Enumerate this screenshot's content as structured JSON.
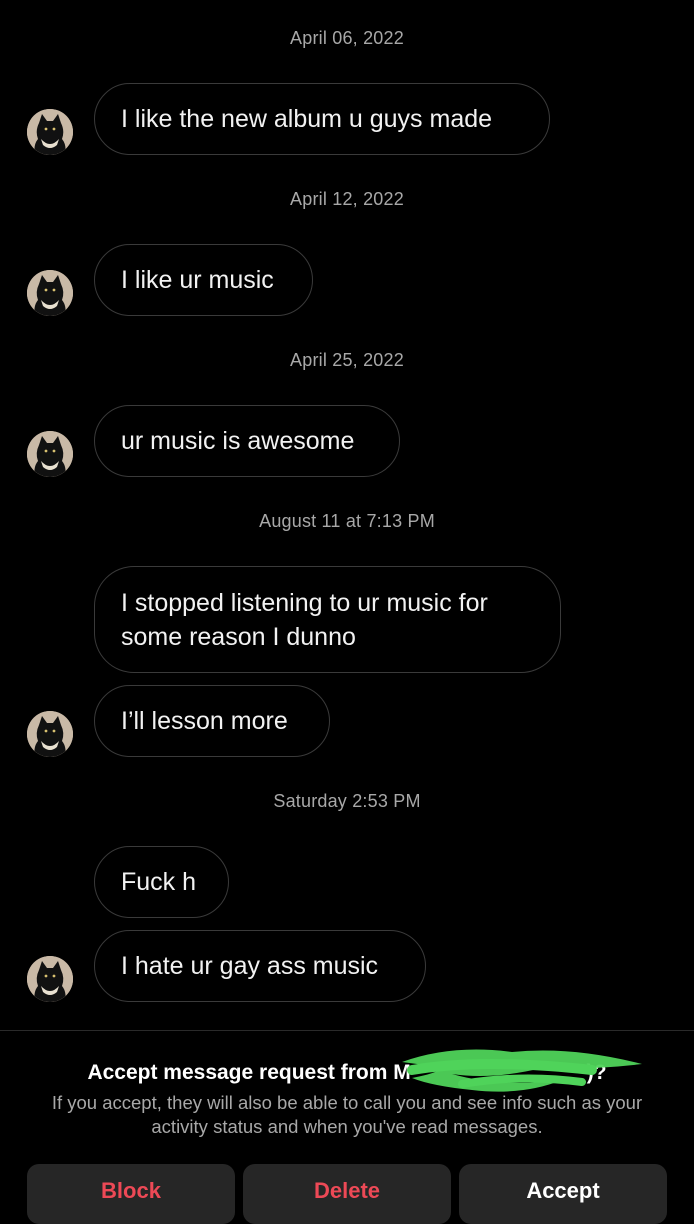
{
  "thread": {
    "timestamps": [
      "April 06, 2022",
      "April 12, 2022",
      "April 25, 2022",
      "August 11 at 7:13 PM",
      "Saturday 2:53 PM"
    ],
    "messages": [
      "I like the new album u guys made",
      "I like ur music",
      "ur music is awesome",
      "I stopped listening to ur music for some reason I dunno",
      "I’ll lesson more",
      "Fuck h",
      "I hate ur gay ass music"
    ]
  },
  "request": {
    "title_prefix": "Accept message request from M",
    "title_suffix": ")?",
    "body": "If you accept, they will also be able to call you and see info such as your activity status and when you've read messages."
  },
  "actions": {
    "block": "Block",
    "delete": "Delete",
    "accept": "Accept"
  },
  "colors": {
    "background": "#000000",
    "bubble_border": "#3a3a3a",
    "timestamp": "#a8a8a8",
    "button_bg": "#262626",
    "destructive": "#ed4956",
    "redaction": "#4fd35a"
  },
  "icons": {
    "avatar": "black-cat-avatar-icon"
  }
}
